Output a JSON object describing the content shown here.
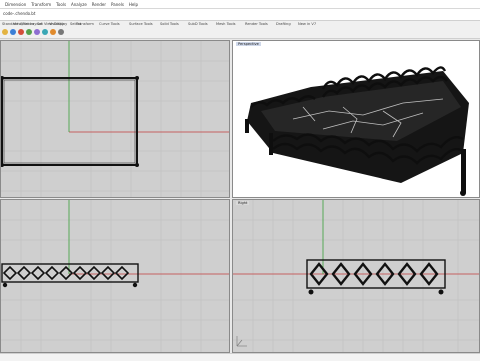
{
  "menu": [
    "Dimension",
    "Transform",
    "Tools",
    "Analyze",
    "Render",
    "Panels",
    "Help"
  ],
  "command_line": {
    "text": "code-.chendo.bt"
  },
  "toolbar_tabs": [
    "Standard",
    "CPlanes",
    "Set View",
    "Display",
    "Select",
    "Viewport Layout",
    "Visibility",
    "Transform",
    "Curve Tools",
    "Surface Tools",
    "Solid Tools",
    "SubD Tools",
    "Mesh Tools",
    "Render Tools",
    "Drafting",
    "New in V7"
  ],
  "viewports": {
    "top": {
      "title": ""
    },
    "perspective": {
      "title": "Perspective"
    },
    "front": {
      "title": ""
    },
    "right": {
      "title": "Right"
    }
  },
  "colors": {
    "grid_bg": "#cfcfcf",
    "grid_line": "#bdbdbd",
    "x_axis": "#c33b3b",
    "y_axis": "#39a139",
    "viewport_border": "#8a8a8a"
  },
  "icons": [
    "new-file-icon",
    "open-icon",
    "save-icon",
    "print-icon",
    "cut-icon",
    "copy-icon",
    "paste-icon",
    "undo-icon"
  ]
}
